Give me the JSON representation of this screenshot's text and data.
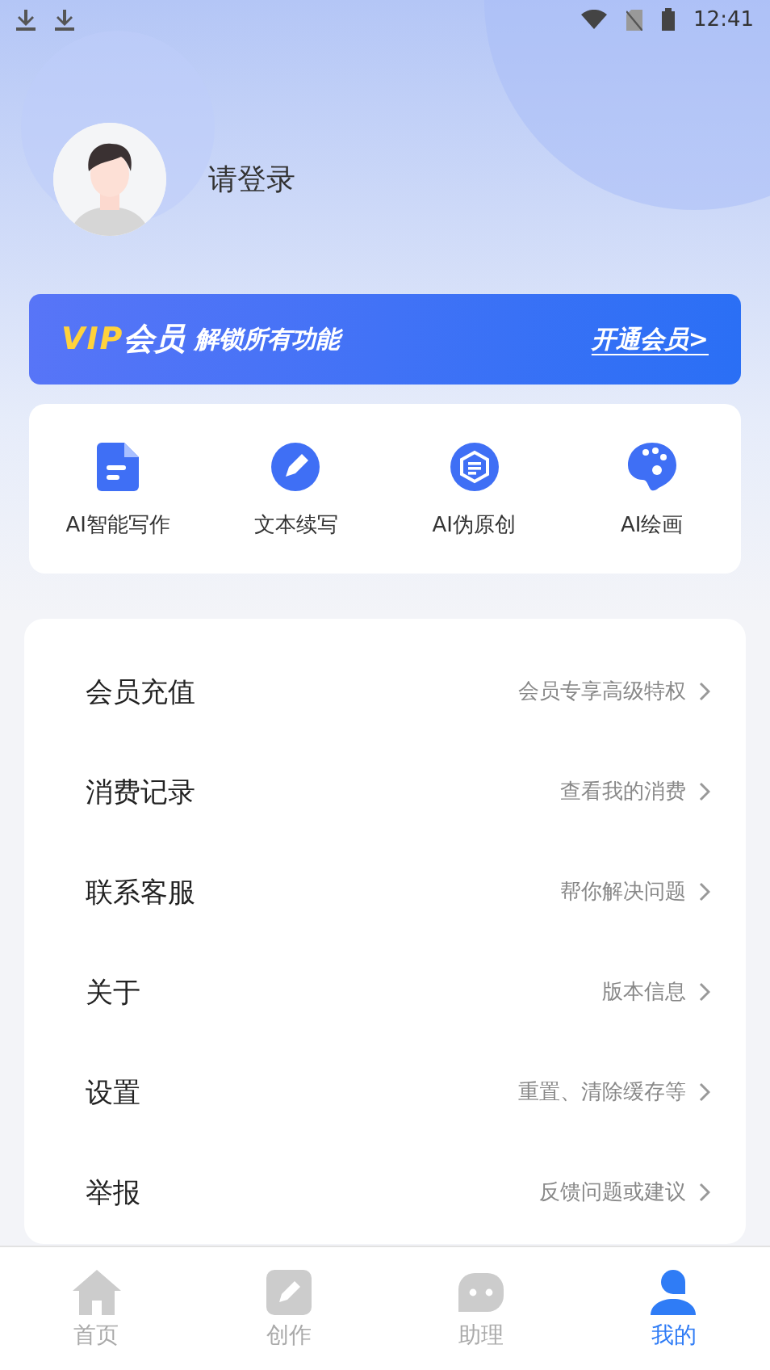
{
  "status_bar": {
    "time": "12:41"
  },
  "profile": {
    "login_prompt": "请登录"
  },
  "vip_banner": {
    "title_highlight": "VIP",
    "title_rest": "会员",
    "subtitle": "解锁所有功能",
    "action": "开通会员>"
  },
  "features": [
    {
      "kind": "document",
      "label": "AI智能写作"
    },
    {
      "kind": "pencil",
      "label": "文本续写"
    },
    {
      "kind": "shield",
      "label": "AI伪原创"
    },
    {
      "kind": "palette",
      "label": "AI绘画"
    }
  ],
  "menu": [
    {
      "label": "会员充值",
      "hint": "会员专享高级特权"
    },
    {
      "label": "消费记录",
      "hint": "查看我的消费"
    },
    {
      "label": "联系客服",
      "hint": "帮你解决问题"
    },
    {
      "label": "关于",
      "hint": "版本信息"
    },
    {
      "label": "设置",
      "hint": "重置、清除缓存等"
    },
    {
      "label": "举报",
      "hint": "反馈问题或建议"
    }
  ],
  "tab_bar": [
    {
      "kind": "home",
      "label": "首页",
      "selected": false
    },
    {
      "kind": "create",
      "label": "创作",
      "selected": false
    },
    {
      "kind": "chat",
      "label": "助理",
      "selected": false
    },
    {
      "kind": "me",
      "label": "我的",
      "selected": true
    }
  ]
}
